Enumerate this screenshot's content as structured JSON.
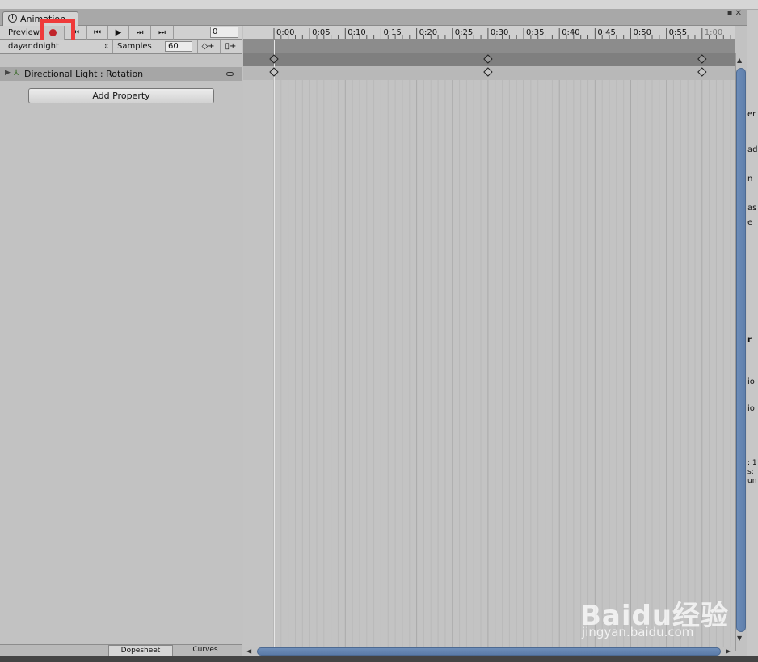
{
  "window": {
    "tab_title": "Animation",
    "controls": "▪ ✕"
  },
  "toolbar": {
    "preview_label": "Preview",
    "frame_value": "0"
  },
  "clip": {
    "name": "dayandnight",
    "samples_label": "Samples",
    "samples_value": "60"
  },
  "properties": [
    {
      "label": "Directional Light : Rotation"
    }
  ],
  "add_property_label": "Add Property",
  "bottom_tabs": {
    "dopesheet": "Dopesheet",
    "curves": "Curves"
  },
  "ruler": {
    "ticks": [
      "0:00",
      "0:05",
      "0:10",
      "0:15",
      "0:20",
      "0:25",
      "0:30",
      "0:35",
      "0:40",
      "0:45",
      "0:50",
      "0:55",
      "1:00"
    ]
  },
  "keyframes_seconds": [
    0,
    30,
    60
  ],
  "right_pane_fragments": [
    "er",
    "ad",
    "n",
    "as",
    "e",
    "r",
    "io",
    "io",
    ": 1",
    "s:",
    "un"
  ],
  "watermark": {
    "brand": "Baidu经验",
    "url": "jingyan.baidu.com"
  },
  "colors": {
    "record": "#c0242a",
    "highlight": "#ef3a3a",
    "scroll": "#5f7fac"
  }
}
